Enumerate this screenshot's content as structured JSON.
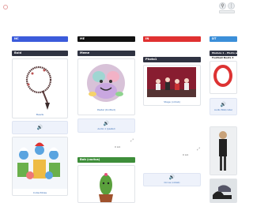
{
  "columns": [
    {
      "label": "NC",
      "color": "#3b5bdb"
    },
    {
      "label": "ME",
      "color": "#111111"
    },
    {
      "label": "IN",
      "color": "#e03131"
    },
    {
      "label": "DT",
      "color": "#3b8fd9"
    }
  ],
  "sections": {
    "col1_header": "Bold",
    "col2_header": "Meme",
    "col2_header_green": "Bob (cactus)",
    "col3_header": "Photo1",
    "col4_header_1": "Module 1 - Photo w",
    "col4_header_2": "Football Boots 3"
  },
  "captions": {
    "necklace": "Beads",
    "plush": "Pastel (Knitted)",
    "audio_plush": "Audio 1 (pastel)",
    "stage": "Stage (collab)",
    "audio_stage": "Circus (collab)",
    "smurfs": "Collectibles",
    "audio_col4": "Audio Bob(colle)"
  },
  "counters": {
    "col2": "0 ⊡1",
    "col3": "0 ⊡1"
  },
  "icons": {
    "zoom": "zoom-icon",
    "more": "more-icon",
    "speaker": "speaker-icon"
  }
}
